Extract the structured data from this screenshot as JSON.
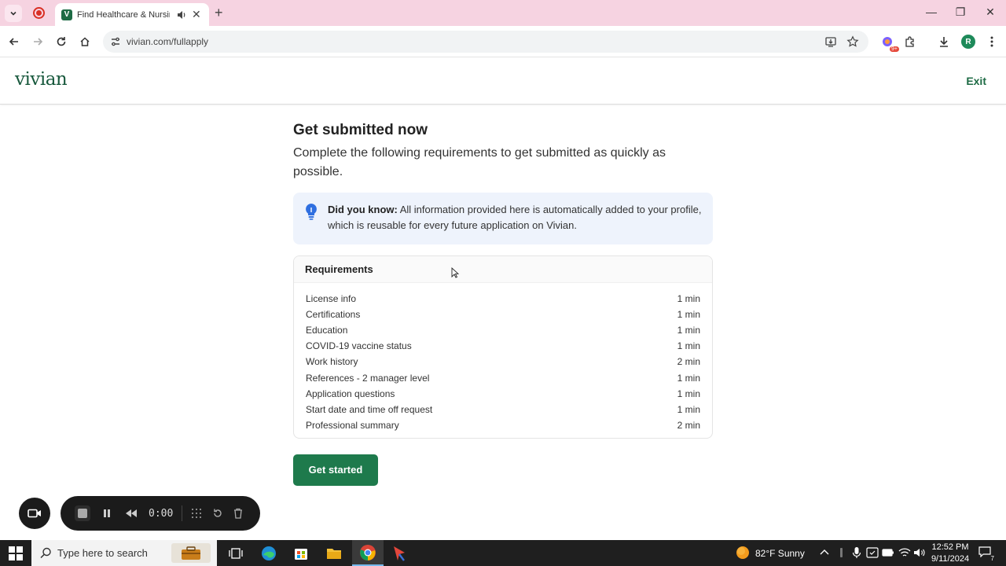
{
  "browser": {
    "tab_title": "Find Healthcare & Nursing",
    "tab_favicon_letter": "V",
    "url": "vivian.com/fullapply",
    "profile_initial": "R",
    "extension_badge": "9+"
  },
  "header": {
    "logo": "vivian",
    "exit_label": "Exit"
  },
  "main": {
    "title": "Get submitted now",
    "subtitle": "Complete the following requirements to get submitted as quickly as possible.",
    "tip": {
      "bold": "Did you know:",
      "text": " All information provided here is automatically added to your profile, which is reusable for every future application on Vivian."
    },
    "requirements": {
      "heading": "Requirements",
      "items": [
        {
          "label": "License info",
          "time": "1 min"
        },
        {
          "label": "Certifications",
          "time": "1 min"
        },
        {
          "label": "Education",
          "time": "1 min"
        },
        {
          "label": "COVID-19 vaccine status",
          "time": "1 min"
        },
        {
          "label": "Work history",
          "time": "2 min"
        },
        {
          "label": "References - 2 manager level",
          "time": "1 min"
        },
        {
          "label": "Application questions",
          "time": "1 min"
        },
        {
          "label": "Start date and time off request",
          "time": "1 min"
        },
        {
          "label": "Professional summary",
          "time": "2 min"
        }
      ]
    },
    "cta_label": "Get started"
  },
  "recorder": {
    "time": "0:00"
  },
  "taskbar": {
    "search_placeholder": "Type here to search",
    "weather": "82°F  Sunny",
    "time": "12:52 PM",
    "date": "9/11/2024",
    "notification_count": "7"
  },
  "colors": {
    "brand_green": "#1e7a4c",
    "tip_background": "#eef3fc",
    "tabstrip": "#f6d3e1"
  }
}
